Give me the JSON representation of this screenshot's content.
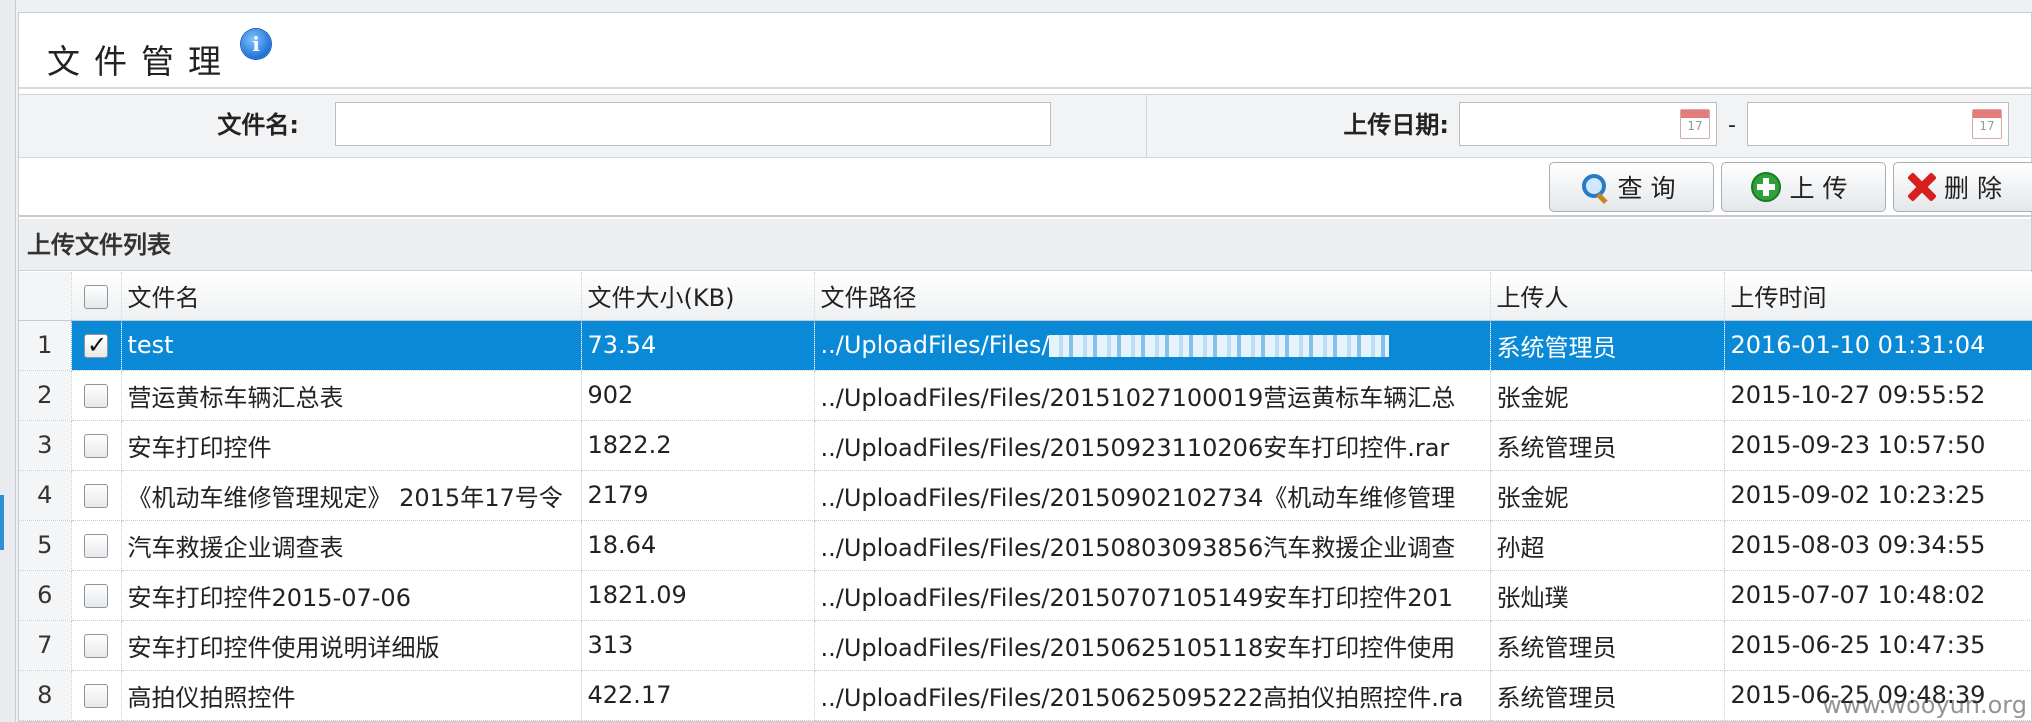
{
  "page": {
    "title": "文件管理",
    "info_icon": "info-icon"
  },
  "search": {
    "filename_label": "文件名:",
    "filename_value": "",
    "upload_date_label": "上传日期:",
    "date_from": "",
    "date_to": "",
    "date_separator": "-",
    "calendar_icon_text": "17"
  },
  "toolbar": {
    "query_label": "查询",
    "upload_label": "上传",
    "delete_label": "删除"
  },
  "list": {
    "title": "上传文件列表",
    "columns": [
      "",
      "",
      "文件名",
      "文件大小(KB)",
      "文件路径",
      "上传人",
      "上传时间"
    ],
    "rows": [
      {
        "index": "1",
        "checked": true,
        "name": "test",
        "size": "73.54",
        "path": "../UploadFiles/Files/",
        "uploader": "系统管理员",
        "time": "2016-01-10 01:31:04"
      },
      {
        "index": "2",
        "checked": false,
        "name": "营运黄标车辆汇总表",
        "size": "902",
        "path": "../UploadFiles/Files/20151027100019营运黄标车辆汇总",
        "uploader": "张金妮",
        "time": "2015-10-27 09:55:52"
      },
      {
        "index": "3",
        "checked": false,
        "name": "安车打印控件",
        "size": "1822.2",
        "path": "../UploadFiles/Files/20150923110206安车打印控件.rar",
        "uploader": "系统管理员",
        "time": "2015-09-23 10:57:50"
      },
      {
        "index": "4",
        "checked": false,
        "name": "《机动车维修管理规定》 2015年17号令",
        "size": "2179",
        "path": "../UploadFiles/Files/20150902102734《机动车维修管理",
        "uploader": "张金妮",
        "time": "2015-09-02 10:23:25"
      },
      {
        "index": "5",
        "checked": false,
        "name": "汽车救援企业调查表",
        "size": "18.64",
        "path": "../UploadFiles/Files/20150803093856汽车救援企业调查",
        "uploader": "孙超",
        "time": "2015-08-03 09:34:55"
      },
      {
        "index": "6",
        "checked": false,
        "name": "安车打印控件2015-07-06",
        "size": "1821.09",
        "path": "../UploadFiles/Files/20150707105149安车打印控件201",
        "uploader": "张灿璞",
        "time": "2015-07-07 10:48:02"
      },
      {
        "index": "7",
        "checked": false,
        "name": "安车打印控件使用说明详细版",
        "size": "313",
        "path": "../UploadFiles/Files/20150625105118安车打印控件使用",
        "uploader": "系统管理员",
        "time": "2015-06-25 10:47:35"
      },
      {
        "index": "8",
        "checked": false,
        "name": "高拍仪拍照控件",
        "size": "422.17",
        "path": "../UploadFiles/Files/20150625095222高拍仪拍照控件.ra",
        "uploader": "系统管理员",
        "time": "2015-06-25 09:48:39"
      }
    ]
  },
  "watermark": "www.wooyun.org",
  "colors": {
    "selected_row": "#0a8ad6",
    "panel_bg": "#ffffff",
    "header_bg": "#eceef0"
  }
}
